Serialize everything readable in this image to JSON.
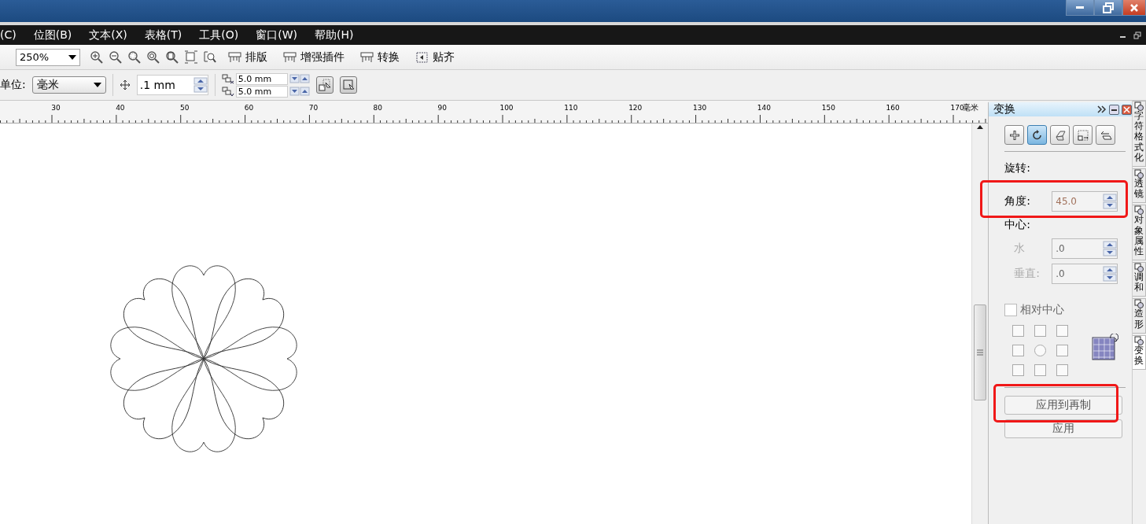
{
  "menu_bar": {
    "items": [
      "(C)",
      "位图(B)",
      "文本(X)",
      "表格(T)",
      "工具(O)",
      "窗口(W)",
      "帮助(H)"
    ]
  },
  "toolbar": {
    "zoom": "250%",
    "buttons": [
      "排版",
      "增强插件",
      "转换",
      "贴齐"
    ]
  },
  "property_bar": {
    "unit_label": "单位:",
    "unit": "毫米",
    "nudge": ".1 mm",
    "duplicate_x": "5.0 mm",
    "duplicate_y": "5.0 mm"
  },
  "ruler": {
    "labels": [
      "30",
      "40",
      "50",
      "60",
      "70",
      "80",
      "90",
      "100",
      "110",
      "120",
      "130",
      "140",
      "150",
      "160",
      "170"
    ],
    "unit": "毫米"
  },
  "docker": {
    "title": "变换",
    "modes": [
      {
        "kind": "position",
        "selected": false
      },
      {
        "kind": "rotate",
        "selected": true
      },
      {
        "kind": "scale",
        "selected": false
      },
      {
        "kind": "size",
        "selected": false
      },
      {
        "kind": "skew",
        "selected": false
      }
    ],
    "section": "旋转:",
    "angle_label": "角度:",
    "angle": "45.0",
    "center_label": "中心:",
    "center_fields": [
      {
        "label": "水",
        "value": ".0",
        "disabled": true
      },
      {
        "label": "垂直:",
        "value": ".0",
        "disabled": true
      }
    ],
    "relative_center": {
      "label": "相对中心",
      "checked": false
    },
    "anchors": [
      {
        "selected": false
      },
      {
        "selected": false
      },
      {
        "selected": false
      },
      {
        "selected": false
      },
      {
        "selected": true
      },
      {
        "selected": false
      },
      {
        "selected": false
      },
      {
        "selected": false
      },
      {
        "selected": false
      }
    ],
    "buttons": [
      "应用到再制",
      "应用"
    ]
  },
  "side_tabs": [
    {
      "label": "字符格式化",
      "selected": false
    },
    {
      "label": "透镜",
      "selected": false
    },
    {
      "label": "对象属性",
      "selected": false
    },
    {
      "label": "调和",
      "selected": false
    },
    {
      "label": "造形",
      "selected": false
    },
    {
      "label": "变换",
      "selected": true
    }
  ]
}
